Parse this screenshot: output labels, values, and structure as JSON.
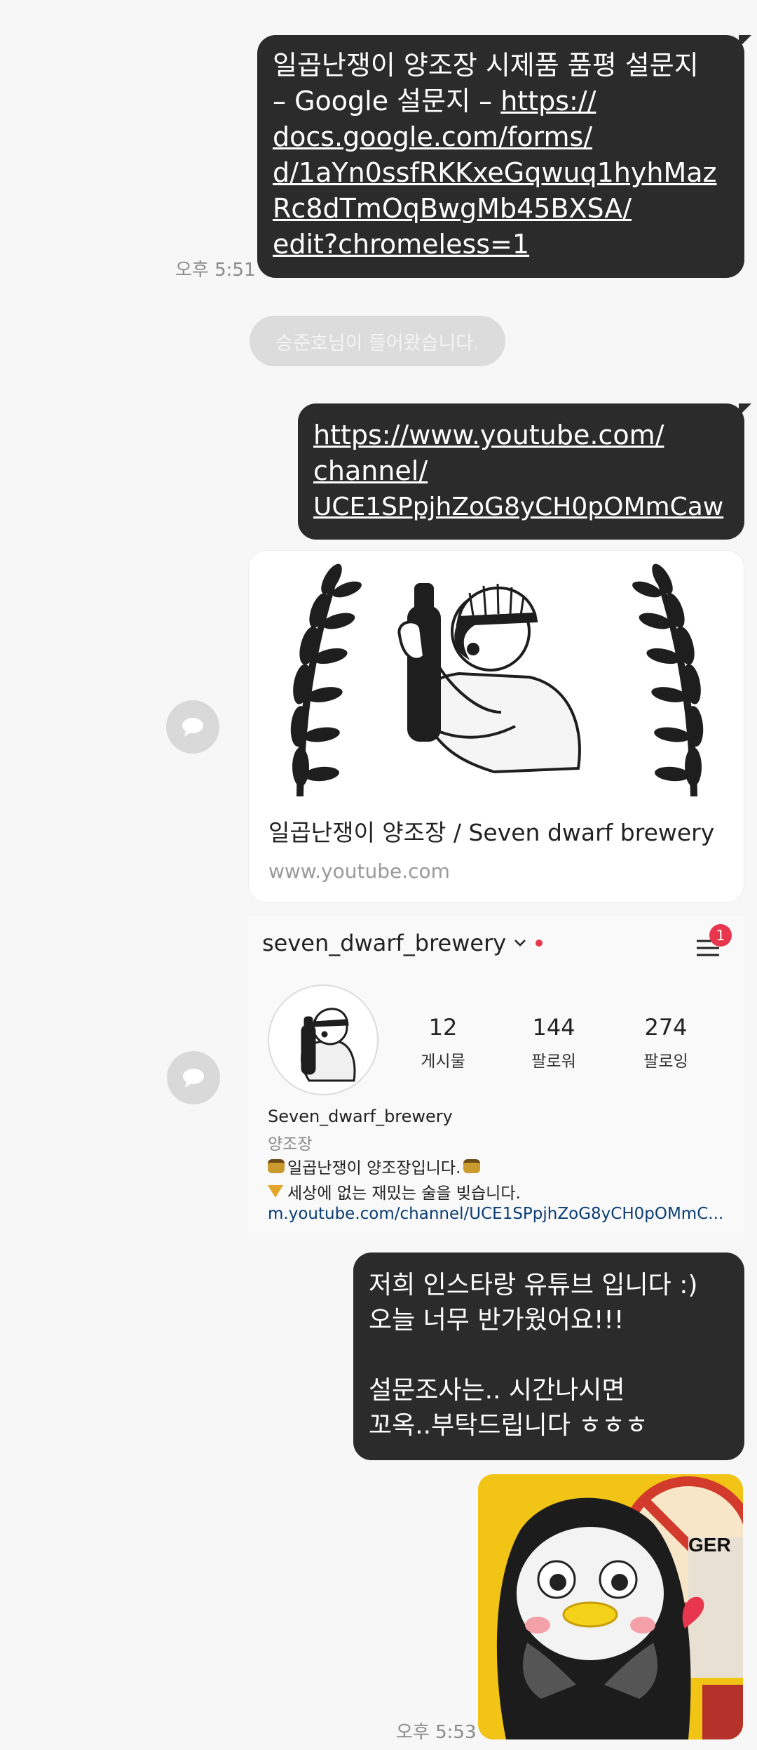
{
  "messages": {
    "survey": {
      "time": "오후 5:51",
      "text_line1": "일곱난쟁이 양조장 시제품 품평 설문지",
      "text_prefix": "– Google 설문지 – ",
      "link_lines": [
        "https://",
        "docs.google.com/forms/",
        "d/1aYn0ssfRKKxeGqwuq1hyhMaz",
        "Rc8dTmOqBwgMb45BXSA/",
        "edit?chromeless=1"
      ]
    },
    "system_notice": "승준호님이 들어왔습니다.",
    "youtube_link": {
      "lines": [
        "https://www.youtube.com/",
        "channel/",
        "UCE1SPpjhZoG8yCH0pOMmCaw"
      ]
    },
    "youtube_preview": {
      "title": "일곱난쟁이 양조장 / Seven dwarf brewery",
      "domain": "www.youtube.com"
    },
    "instagram_card": {
      "username": "seven_dwarf_brewery",
      "notification_count": "1",
      "stats": [
        {
          "value": "12",
          "label": "게시물"
        },
        {
          "value": "144",
          "label": "팔로워"
        },
        {
          "value": "274",
          "label": "팔로잉"
        }
      ],
      "display_name": "Seven_dwarf_brewery",
      "category": "양조장",
      "bio_line1": "일곱난쟁이 양조장입니다.",
      "bio_line2": "세상에 없는 재밌는 술을 빚습니다.",
      "bio_link": "m.youtube.com/channel/UCE1SPpjhZoG8yCH0pOMmC..."
    },
    "greeting": {
      "lines": [
        "저희 인스타랑 유튜브 입니다 :)",
        "오늘 너무 반가웠어요!!!",
        "",
        "설문조사는.. 시간나시면",
        "꼬옥..부탁드립니다 ㅎㅎㅎ"
      ]
    },
    "photo": {
      "time": "오후 5:53",
      "sign_text": "GER"
    }
  },
  "icons": {
    "share": "share-bubble-icon",
    "menu": "hamburger-menu-icon",
    "dropdown": "chevron-down-icon"
  },
  "colors": {
    "bubble_dark": "#2b2b2b",
    "background": "#f7f7f7",
    "notice_pill": "#dcdcdc",
    "insta_badge": "#e8364e",
    "link_blue": "#0a3d73"
  }
}
